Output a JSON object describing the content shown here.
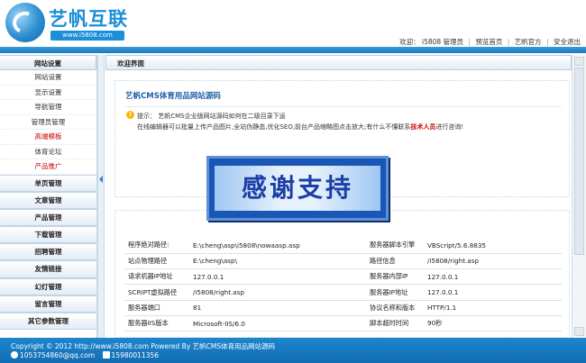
{
  "header": {
    "logo_text": "艺帆互联",
    "logo_url": "www.i5808.com",
    "welcome": "欢迎：",
    "user": "i5808 管理员",
    "links": [
      "预览首页",
      "艺帆官方",
      "安全退出"
    ]
  },
  "sidebar": {
    "head": "网站设置",
    "sub_items": [
      {
        "label": "网站设置",
        "highlight": false
      },
      {
        "label": "显示设置",
        "highlight": false
      },
      {
        "label": "导航管理",
        "highlight": false
      },
      {
        "label": "管理员管理",
        "highlight": false
      },
      {
        "label": "高端模板",
        "highlight": true
      },
      {
        "label": "体育论坛",
        "highlight": false
      },
      {
        "label": "产品推广",
        "highlight": true
      }
    ],
    "groups": [
      "单页管理",
      "文章管理",
      "产品管理",
      "下载管理",
      "招聘管理",
      "友情链接",
      "幻灯管理",
      "留言管理",
      "其它参数管理"
    ]
  },
  "main": {
    "title": "欢迎界面",
    "box_title": "艺帆CMS体育用品网站源码",
    "tip_label": "提示：",
    "tip_text": "艺帆CMS企业版网站源码如何在二级目录下运",
    "tip_line2_before": "在线编辑器可以批量上传产品图片,全站伪静态,优化SEO,前台产品缩略图点击放大;有什么不懂联系",
    "tip_line2_highlight": "技术人员",
    "tip_line2_after": "进行咨询!",
    "banner_text": "感谢支持"
  },
  "server_info": [
    [
      "程序绝对路径:",
      "E:\\cheng\\asp\\i5808\\nowaasp.asp",
      "服务器脚本引擎",
      "VBScript/5.6.8835"
    ],
    [
      "站点物理路径",
      "E:\\cheng\\asp\\",
      "路径信息",
      "/i5808/right.asp"
    ],
    [
      "请求机器IP地址",
      "127.0.0.1",
      "服务器内部IP",
      "127.0.0.1"
    ],
    [
      "SCRIPT虚拟路径",
      "/i5808/right.asp",
      "服务器IP地址",
      "127.0.0.1"
    ],
    [
      "服务器端口",
      "81",
      "协议名称和版本",
      "HTTP/1.1"
    ],
    [
      "服务器IIS版本",
      "Microsoft-IIS/6.0",
      "脚本超时时间",
      "90秒"
    ]
  ],
  "footer": {
    "copyright": "Copyright © 2012 http://www.i5808.com Powered By 艺帆CMS体育用品网站源码",
    "qq": "1053754860@qq.com",
    "phone": "15980011356"
  },
  "colors": {
    "accent": "#1b8fd8",
    "footer_bg": "#1d86cf",
    "highlight_red": "#cc0000"
  }
}
